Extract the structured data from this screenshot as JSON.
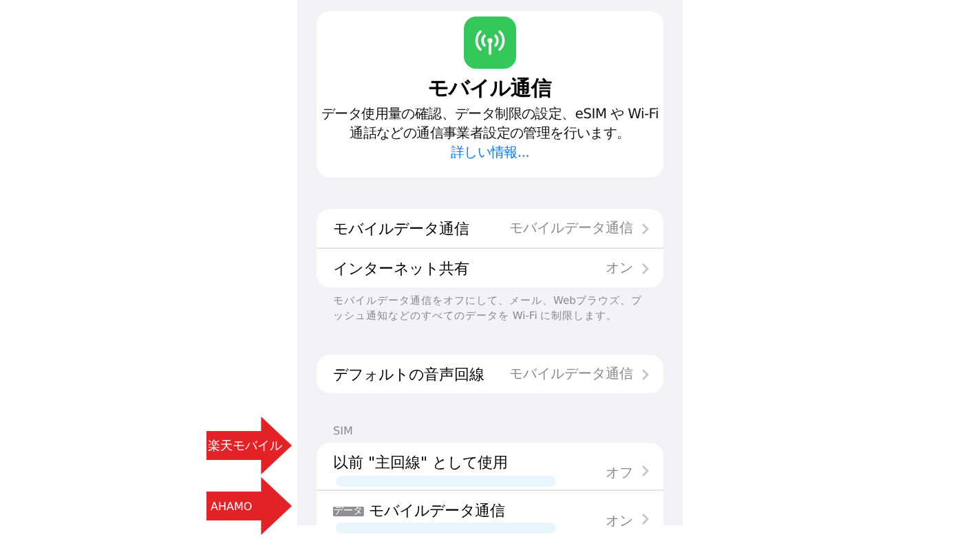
{
  "header": {
    "title": "モバイル通信",
    "description": "データ使用量の確認、データ制限の設定、eSIM や Wi-Fi 通話などの通信事業者設定の管理を行います。",
    "link": "詳しい情報..."
  },
  "groups": [
    {
      "rows": [
        {
          "label": "モバイルデータ通信",
          "value": "モバイルデータ通信"
        },
        {
          "label": "インターネット共有",
          "value": "オン"
        }
      ],
      "footer": "モバイルデータ通信をオフにして、メール、Webブラウズ、プッシュ通知などのすべてのデータを Wi-Fi に制限します。"
    },
    {
      "rows": [
        {
          "label": "デフォルトの音声回線",
          "value": "モバイルデータ通信"
        }
      ]
    },
    {
      "heading": "SIM",
      "rows": [
        {
          "label": "以前 \"主回線\" として使用",
          "value": "オフ",
          "redacted": true
        },
        {
          "badge": "データ",
          "label": "モバイルデータ通信",
          "value": "オン",
          "redacted": true
        }
      ]
    }
  ],
  "annotations": [
    {
      "text": "楽天モバイル"
    },
    {
      "text": "AHAMO"
    }
  ]
}
